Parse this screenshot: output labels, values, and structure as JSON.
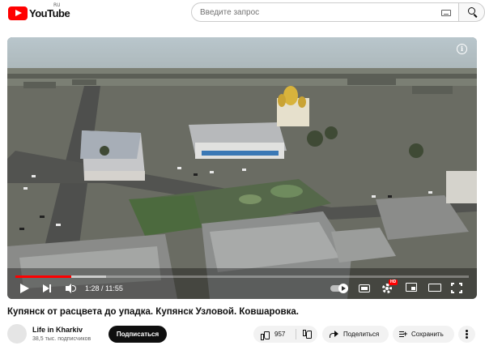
{
  "header": {
    "logo_text": "YouTube",
    "logo_region": "RU",
    "search_placeholder": "Введите запрос",
    "icons": [
      "youtube-logo-icon",
      "keyboard-icon",
      "search-icon"
    ]
  },
  "player": {
    "current_time": "1:28",
    "duration": "11:55",
    "time_display": "1:28 / 11:55",
    "progress_fraction": 0.123,
    "buffered_fraction": 0.2,
    "hd_badge": "HD",
    "info_symbol": "i",
    "autoplay_on": true,
    "icons": [
      "play-icon",
      "next-icon",
      "volume-icon",
      "autoplay-toggle-icon",
      "subtitles-icon",
      "settings-icon",
      "miniplayer-icon",
      "theater-icon",
      "fullscreen-icon",
      "info-icon"
    ]
  },
  "video": {
    "title": "Купянск от расцвета до упадка. Купянск Узловой. Ковшаровка."
  },
  "channel": {
    "name": "Life in Kharkiv",
    "subscribers": "38,5 тыс. подписчиков",
    "subscribe_label": "Подписаться"
  },
  "actions": {
    "like_count": "957",
    "share_label": "Поделиться",
    "save_label": "Сохранить"
  },
  "colors": {
    "accent_red": "#ff0000",
    "text_primary": "#0f0f0f",
    "text_secondary": "#606060",
    "pill_bg": "#f2f2f2"
  }
}
